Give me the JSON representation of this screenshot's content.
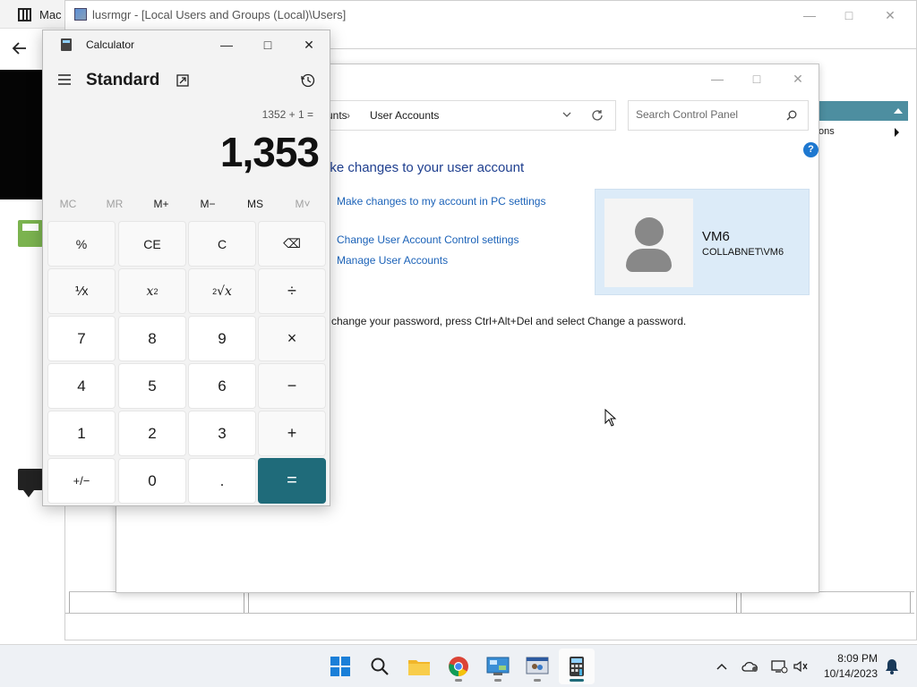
{
  "browser": {
    "tab_title": "Mac"
  },
  "lusrmgr": {
    "title": "lusrmgr - [Local Users and Groups (Local)\\Users]",
    "right_panel_item": "ons"
  },
  "control_panel": {
    "breadcrumb_partial": "unts",
    "breadcrumb_current": "User Accounts",
    "search_placeholder": "Search Control Panel",
    "heading": "ake changes to your user account",
    "links": {
      "pc_settings": "Make changes to my account in PC settings",
      "uac_settings": "Change User Account Control settings",
      "manage_accounts": "Manage User Accounts"
    },
    "user": {
      "name": "VM6",
      "domain": "COLLABNET\\VM6"
    },
    "password_note": "change your password, press Ctrl+Alt+Del and select Change a password.",
    "help_label": "?"
  },
  "calculator": {
    "title": "Calculator",
    "mode": "Standard",
    "expression": "1352 + 1 =",
    "display": "1,353",
    "memory": [
      "MC",
      "MR",
      "M+",
      "M−",
      "MS",
      "M˅"
    ],
    "keys": {
      "percent": "%",
      "clear_entry": "CE",
      "clear": "C",
      "backspace": "⌫",
      "reciprocal": "⅟x",
      "square_x": "x",
      "square_exp": "2",
      "sqrt_index": "2",
      "sqrt_x": "√x",
      "divide": "÷",
      "seven": "7",
      "eight": "8",
      "nine": "9",
      "multiply": "×",
      "four": "4",
      "five": "5",
      "six": "6",
      "minus": "−",
      "one": "1",
      "two": "2",
      "three": "3",
      "plus": "+",
      "negate": "+/−",
      "zero": "0",
      "decimal": ".",
      "equals": "="
    }
  },
  "taskbar": {
    "time": "8:09 PM",
    "date": "10/14/2023",
    "apps": [
      "start-icon",
      "search-icon",
      "file-explorer-icon",
      "chrome-icon",
      "control-panel-icon",
      "lusrmgr-icon",
      "calculator-icon"
    ]
  },
  "colors": {
    "accent": "#1f6b7a",
    "link": "#1b62b8",
    "heading": "#1f3f8f",
    "user_card": "#dcebf8"
  }
}
